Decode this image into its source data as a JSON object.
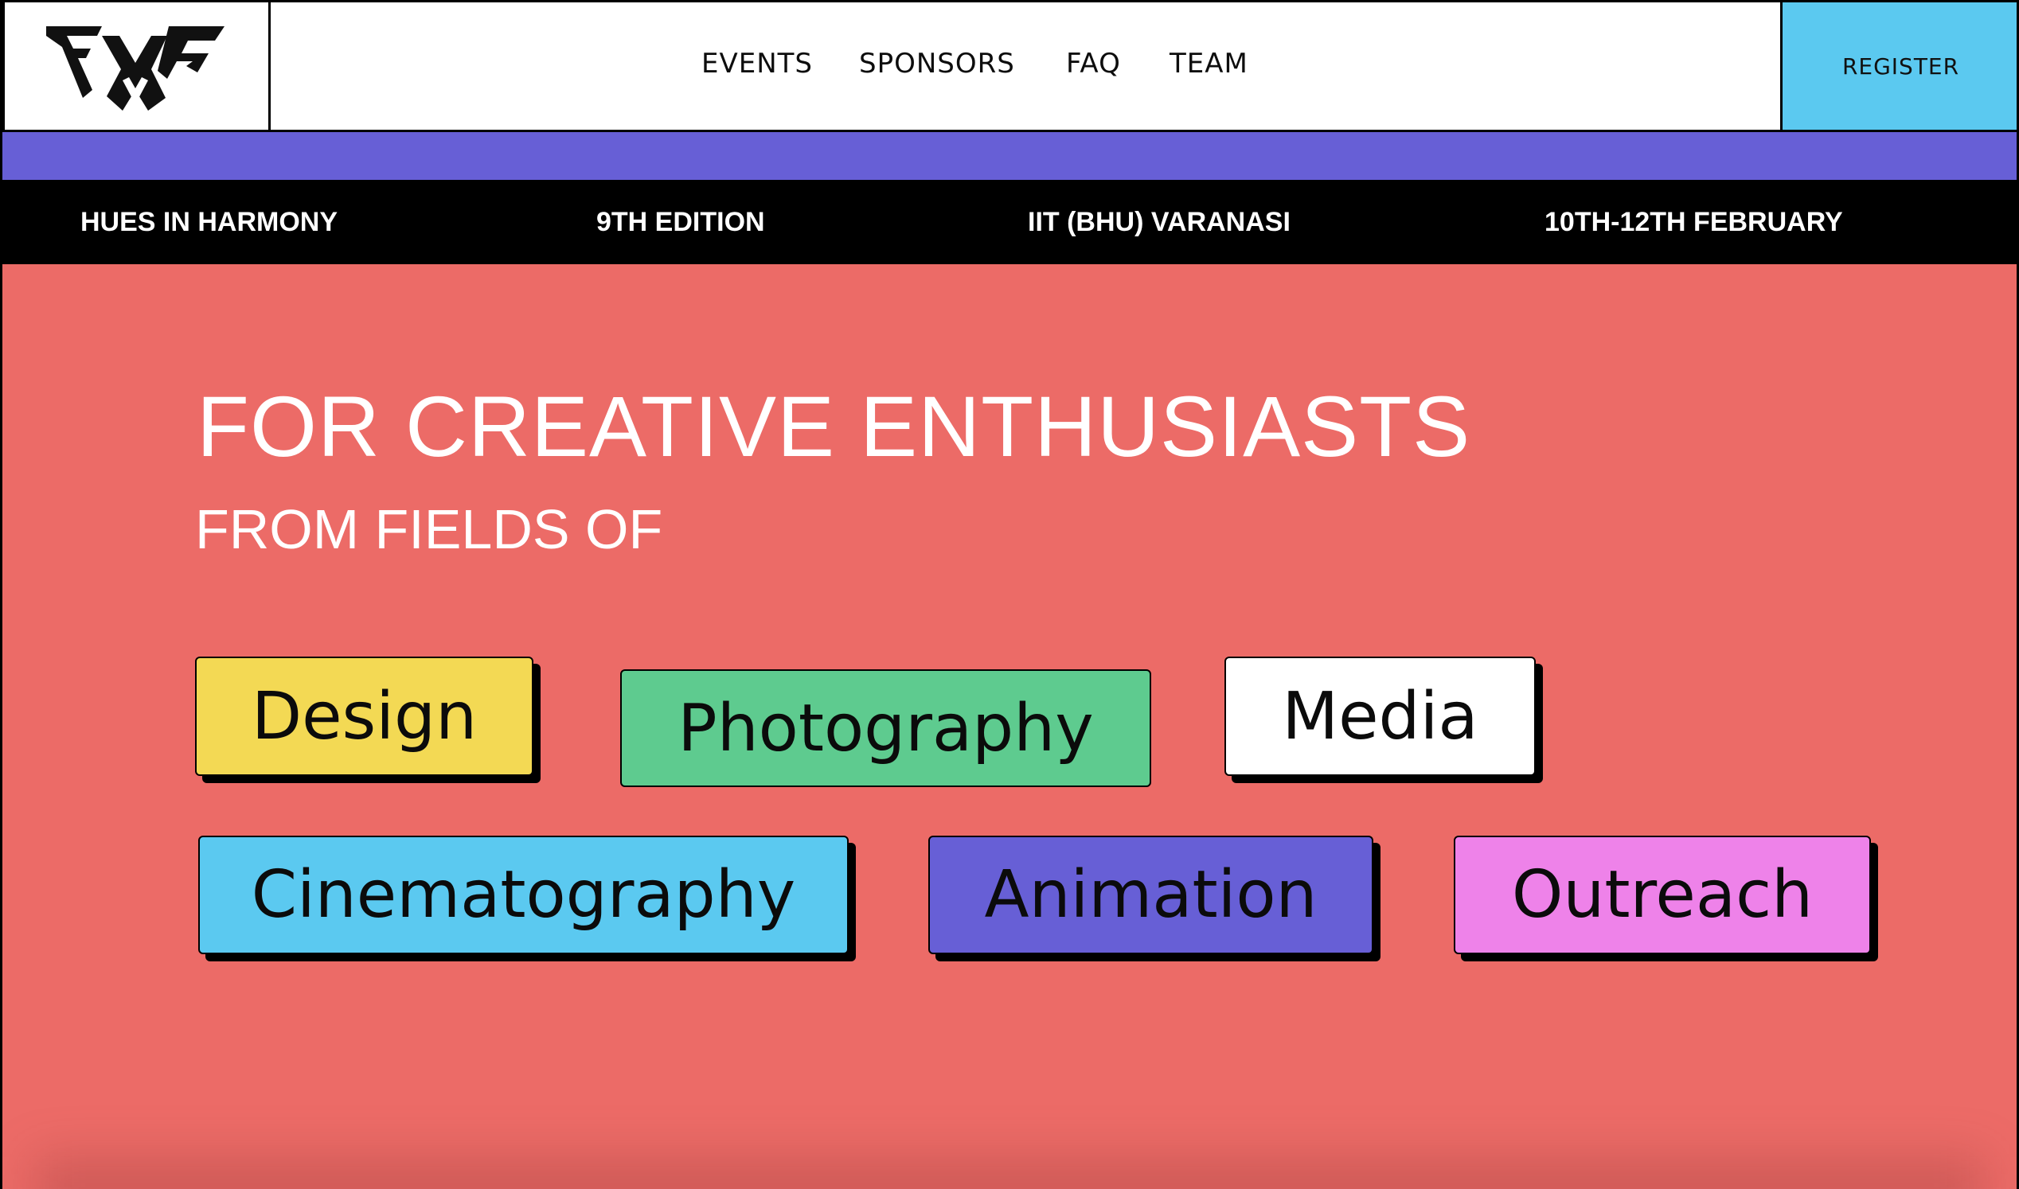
{
  "header": {
    "logo_alt": "FMC",
    "nav": [
      {
        "label": "EVENTS"
      },
      {
        "label": "SPONSORS"
      },
      {
        "label": "FAQ"
      },
      {
        "label": "TEAM"
      }
    ],
    "register_label": "REGISTER"
  },
  "ticker": [
    "HUES IN HARMONY",
    "9TH EDITION",
    "IIT (BHU) VARANASI",
    "10TH-12TH FEBRUARY"
  ],
  "hero": {
    "title": "FOR CREATIVE ENTHUSIASTS",
    "subtitle": "FROM FIELDS OF"
  },
  "fields": [
    {
      "label": "Design",
      "color": "#f3d954"
    },
    {
      "label": "Photography",
      "color": "#5ecb8f"
    },
    {
      "label": "Media",
      "color": "#ffffff"
    },
    {
      "label": "Cinematography",
      "color": "#5bc9f0"
    },
    {
      "label": "Animation",
      "color": "#675fd6"
    },
    {
      "label": "Outreach",
      "color": "#ee82e9"
    }
  ],
  "colors": {
    "background": "#ec6b67",
    "band": "#675fd6",
    "register": "#5bc9f0",
    "ticker_bg": "#000000"
  }
}
